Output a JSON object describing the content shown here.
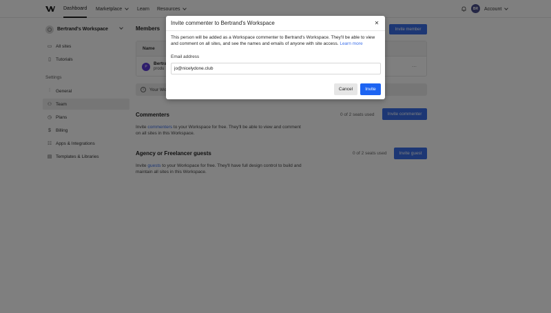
{
  "topnav": {
    "items": [
      {
        "label": "Dashboard"
      },
      {
        "label": "Marketplace"
      },
      {
        "label": "Learn"
      },
      {
        "label": "Resources"
      }
    ],
    "account_initials": "BR",
    "account_label": "Account"
  },
  "sidebar": {
    "workspace_name": "Bertrand's Workspace",
    "items": [
      {
        "label": "All sites",
        "icon": "folder-icon"
      },
      {
        "label": "Tutorials",
        "icon": "book-icon"
      }
    ],
    "settings_heading": "Settings",
    "settings_items": [
      {
        "label": "General",
        "icon": "sliders-icon"
      },
      {
        "label": "Team",
        "icon": "people-icon"
      },
      {
        "label": "Plans",
        "icon": "plan-icon"
      },
      {
        "label": "Billing",
        "icon": "dollar-icon"
      },
      {
        "label": "Apps & Integrations",
        "icon": "apps-icon"
      },
      {
        "label": "Templates & Libraries",
        "icon": "library-icon"
      }
    ]
  },
  "main": {
    "members_title": "Members",
    "invite_member_label": "Invite member",
    "table_header_name": "Name",
    "row": {
      "avatar_initial": "P",
      "name": "Bertra",
      "sub": "produ"
    },
    "notice_text": "Your Wo",
    "commenters": {
      "title": "Commenters",
      "seats": "0 of 2 seats used",
      "button": "Invite commenter",
      "desc_before": "Invite ",
      "desc_link": "commenters",
      "desc_after": " to your Workspace for free. They'll be able to view and comment on all sites in this Workspace."
    },
    "guests": {
      "title": "Agency or Freelancer guests",
      "seats": "0 of 2 seats used",
      "button": "Invite guest",
      "desc_before": "Invite ",
      "desc_link": "guests",
      "desc_after": " to your Workspace for free. They'll have full design control to build and maintain all sites in this Workspace."
    }
  },
  "modal": {
    "title": "Invite commenter to Bertrand's Workspace",
    "body": "This person will be added as a Workspace commenter to Bertrand's Workspace. They'll be able to view and comment on all sites, and see the names and emails of anyone with site access. ",
    "learn_more": "Learn more",
    "email_label": "Email address",
    "email_value": "jo@nicelydone.club",
    "cancel_label": "Cancel",
    "invite_label": "Invite"
  },
  "colors": {
    "accent": "#1d64f2",
    "overlay": "rgba(0,0,0,0.5)"
  }
}
